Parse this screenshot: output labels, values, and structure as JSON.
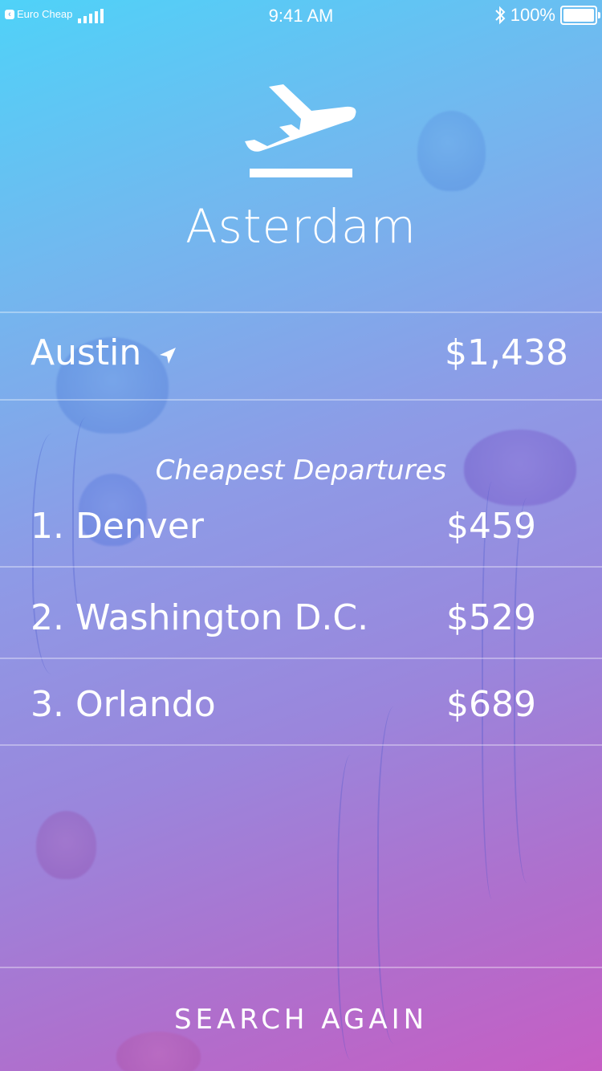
{
  "status_bar": {
    "back_app": "Euro Cheap",
    "time": "9:41 AM",
    "battery": "100%"
  },
  "header": {
    "icon": "airplane-departure-icon",
    "destination": "Asterdam"
  },
  "origin": {
    "city": "Austin",
    "icon": "location-arrow-icon",
    "price": "$1,438"
  },
  "departures": {
    "title": "Cheapest Departures",
    "items": [
      {
        "name": "1. Denver",
        "price": "$459"
      },
      {
        "name": "2. Washington D.C.",
        "price": "$529"
      },
      {
        "name": "3. Orlando",
        "price": "$689"
      }
    ]
  },
  "footer": {
    "search_again_label": "SEARCH AGAIN"
  },
  "colors": {
    "gradient_top": "#4fd2f8",
    "gradient_bottom": "#c65ec4",
    "text": "#ffffff"
  }
}
